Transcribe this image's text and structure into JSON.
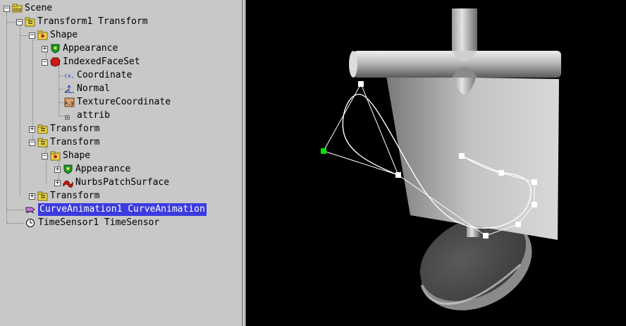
{
  "tree": {
    "nodes": [
      {
        "label": "Scene",
        "icon": "scene-icon",
        "expander": "−"
      },
      {
        "label": "Transform1 Transform",
        "icon": "transform-icon",
        "expander": "−"
      },
      {
        "label": "Shape",
        "icon": "shape-icon",
        "expander": "−"
      },
      {
        "label": "Appearance",
        "icon": "appearance-icon",
        "expander": "+"
      },
      {
        "label": "IndexedFaceSet",
        "icon": "indexed-face-set-icon",
        "expander": "−"
      },
      {
        "label": "Coordinate",
        "icon": "coordinate-icon",
        "expander": ""
      },
      {
        "label": "Normal",
        "icon": "normal-icon",
        "expander": ""
      },
      {
        "label": "TextureCoordinate",
        "icon": "texture-coordinate-icon",
        "expander": ""
      },
      {
        "label": "attrib",
        "icon": "attrib-icon",
        "expander": ""
      },
      {
        "label": "Transform",
        "icon": "transform-icon",
        "expander": "+"
      },
      {
        "label": "Transform",
        "icon": "transform-icon",
        "expander": "−"
      },
      {
        "label": "Shape",
        "icon": "shape-icon",
        "expander": "−"
      },
      {
        "label": "Appearance",
        "icon": "appearance-icon",
        "expander": "+"
      },
      {
        "label": "NurbsPatchSurface",
        "icon": "nurbs-patch-surface-icon",
        "expander": "+"
      },
      {
        "label": "Transform",
        "icon": "transform-icon",
        "expander": "+"
      },
      {
        "label": "CurveAnimation1 CurveAnimation",
        "icon": "curve-animation-icon",
        "expander": "",
        "selected": true
      },
      {
        "label": "TimeSensor1 TimeSensor",
        "icon": "time-sensor-icon",
        "expander": ""
      }
    ]
  },
  "viewport": {
    "background": "#000000",
    "curve_color": "#ffffff",
    "selected_handle_color": "#00e000"
  }
}
